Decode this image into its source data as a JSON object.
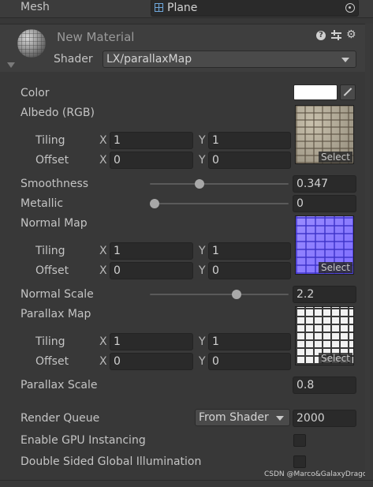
{
  "mesh": {
    "label": "Mesh",
    "value": "Plane"
  },
  "material": {
    "name": "New Material",
    "shader_label": "Shader",
    "shader_value": "LX/parallaxMap"
  },
  "header_icons": [
    "help-icon",
    "preset-icon",
    "settings-icon"
  ],
  "properties": {
    "color": {
      "label": "Color"
    },
    "albedo": {
      "label": "Albedo (RGB)",
      "tiling_label": "Tiling",
      "offset_label": "Offset",
      "tiling_x": "1",
      "tiling_y": "1",
      "offset_x": "0",
      "offset_y": "0",
      "select": "Select"
    },
    "smoothness": {
      "label": "Smoothness",
      "value": "0.347",
      "fraction": 0.347
    },
    "metallic": {
      "label": "Metallic",
      "value": "0",
      "fraction": 0
    },
    "normal_map": {
      "label": "Normal Map",
      "tiling_label": "Tiling",
      "offset_label": "Offset",
      "tiling_x": "1",
      "tiling_y": "1",
      "offset_x": "0",
      "offset_y": "0",
      "select": "Select"
    },
    "normal_scale": {
      "label": "Normal Scale",
      "value": "2.2"
    },
    "parallax_map": {
      "label": "Parallax Map",
      "tiling_label": "Tiling",
      "offset_label": "Offset",
      "tiling_x": "1",
      "tiling_y": "1",
      "offset_x": "0",
      "offset_y": "0",
      "select": "Select"
    },
    "parallax_scale": {
      "label": "Parallax Scale",
      "value": "0.8"
    }
  },
  "axes": {
    "x": "X",
    "y": "Y"
  },
  "render_queue": {
    "label": "Render Queue",
    "dropdown": "From Shader",
    "value": "2000"
  },
  "gpu_instancing": {
    "label": "Enable GPU Instancing"
  },
  "double_sided_gi": {
    "label": "Double Sided Global Illumination"
  },
  "watermark": "CSDN @Marco&GalaxyDragon"
}
